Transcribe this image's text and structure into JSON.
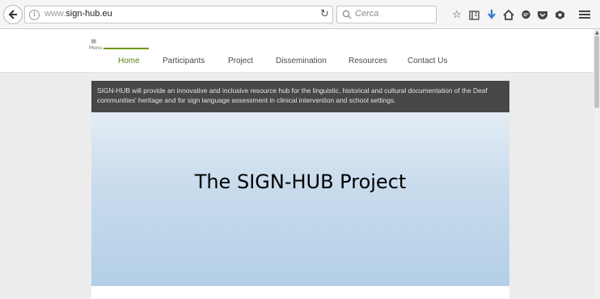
{
  "browser": {
    "url_prefix": "www.",
    "url_domain": "sign-hub.eu",
    "search_placeholder": "Cerca",
    "icons": [
      "back-arrow-icon",
      "info-icon",
      "reload-icon",
      "search-icon",
      "bookmark-star-icon",
      "library-icon",
      "download-icon",
      "home-icon",
      "chat-icon",
      "pocket-icon",
      "extension-icon",
      "hamburger-menu-icon"
    ]
  },
  "nav": {
    "menu_label": "Menu",
    "items": [
      {
        "label": "Home",
        "active": true
      },
      {
        "label": "Participants",
        "active": false
      },
      {
        "label": "Project",
        "active": false
      },
      {
        "label": "Dissemination",
        "active": false
      },
      {
        "label": "Resources",
        "active": false
      },
      {
        "label": "Contact Us",
        "active": false
      }
    ]
  },
  "intro": {
    "text": "SIGN-HUB will provide an innovative and inclusive resource hub for the linguistic, historical and cultural documentation of the Deaf communities' heritage and for sign language assessment in clinical intervention and school settings."
  },
  "hero": {
    "title": "The SIGN-HUB Project"
  },
  "colors": {
    "accent": "#6f9a18",
    "intro_bg": "#474747",
    "hero_top": "#e3ecf4",
    "hero_bottom": "#b3cfe7"
  }
}
